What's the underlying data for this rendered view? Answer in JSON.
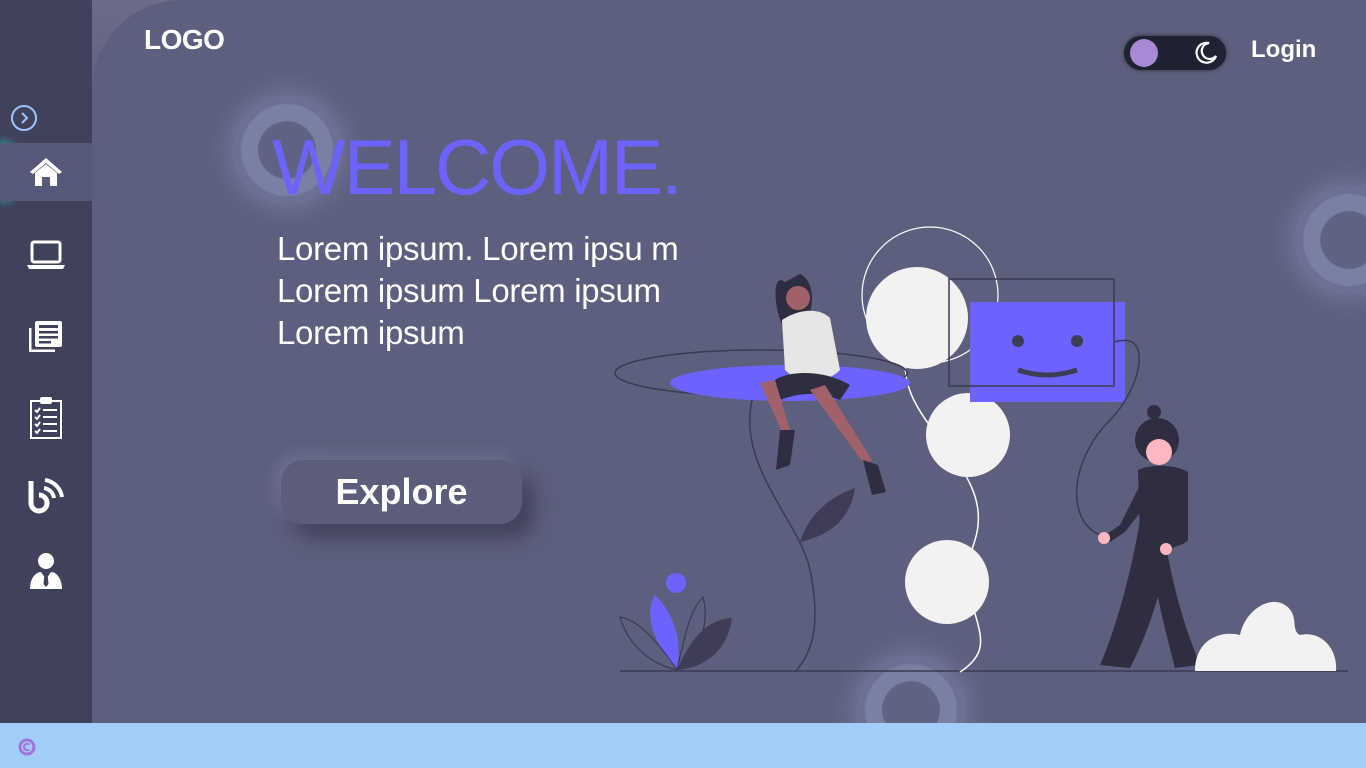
{
  "header": {
    "logo": "LOGO",
    "login_label": "Login"
  },
  "theme_toggle": {
    "mode": "dark",
    "knob_color": "#a889d5",
    "icon": "moon-icon"
  },
  "sidebar": {
    "expand_icon": "chevron-right-icon",
    "active_index": 0,
    "accent_color": "#1de9d0",
    "items": [
      {
        "id": "home",
        "icon": "home-icon"
      },
      {
        "id": "laptop",
        "icon": "laptop-icon"
      },
      {
        "id": "news",
        "icon": "newspaper-icon"
      },
      {
        "id": "tasks",
        "icon": "clipboard-checklist-icon"
      },
      {
        "id": "blog",
        "icon": "blog-icon"
      },
      {
        "id": "profile",
        "icon": "user-tie-icon"
      }
    ]
  },
  "hero": {
    "title": "WELCOME.",
    "description": "Lorem ipsum. Lorem ipsu m Lorem ipsum Lorem ipsum Lorem ipsum",
    "explore_label": "Explore",
    "title_color": "#6c63ff"
  },
  "footer": {
    "icon": "copyright-icon"
  },
  "colors": {
    "background": "#5d5f7e",
    "sidebar": "#40415b",
    "accent": "#6c63ff",
    "footer": "#a2cdf7"
  }
}
